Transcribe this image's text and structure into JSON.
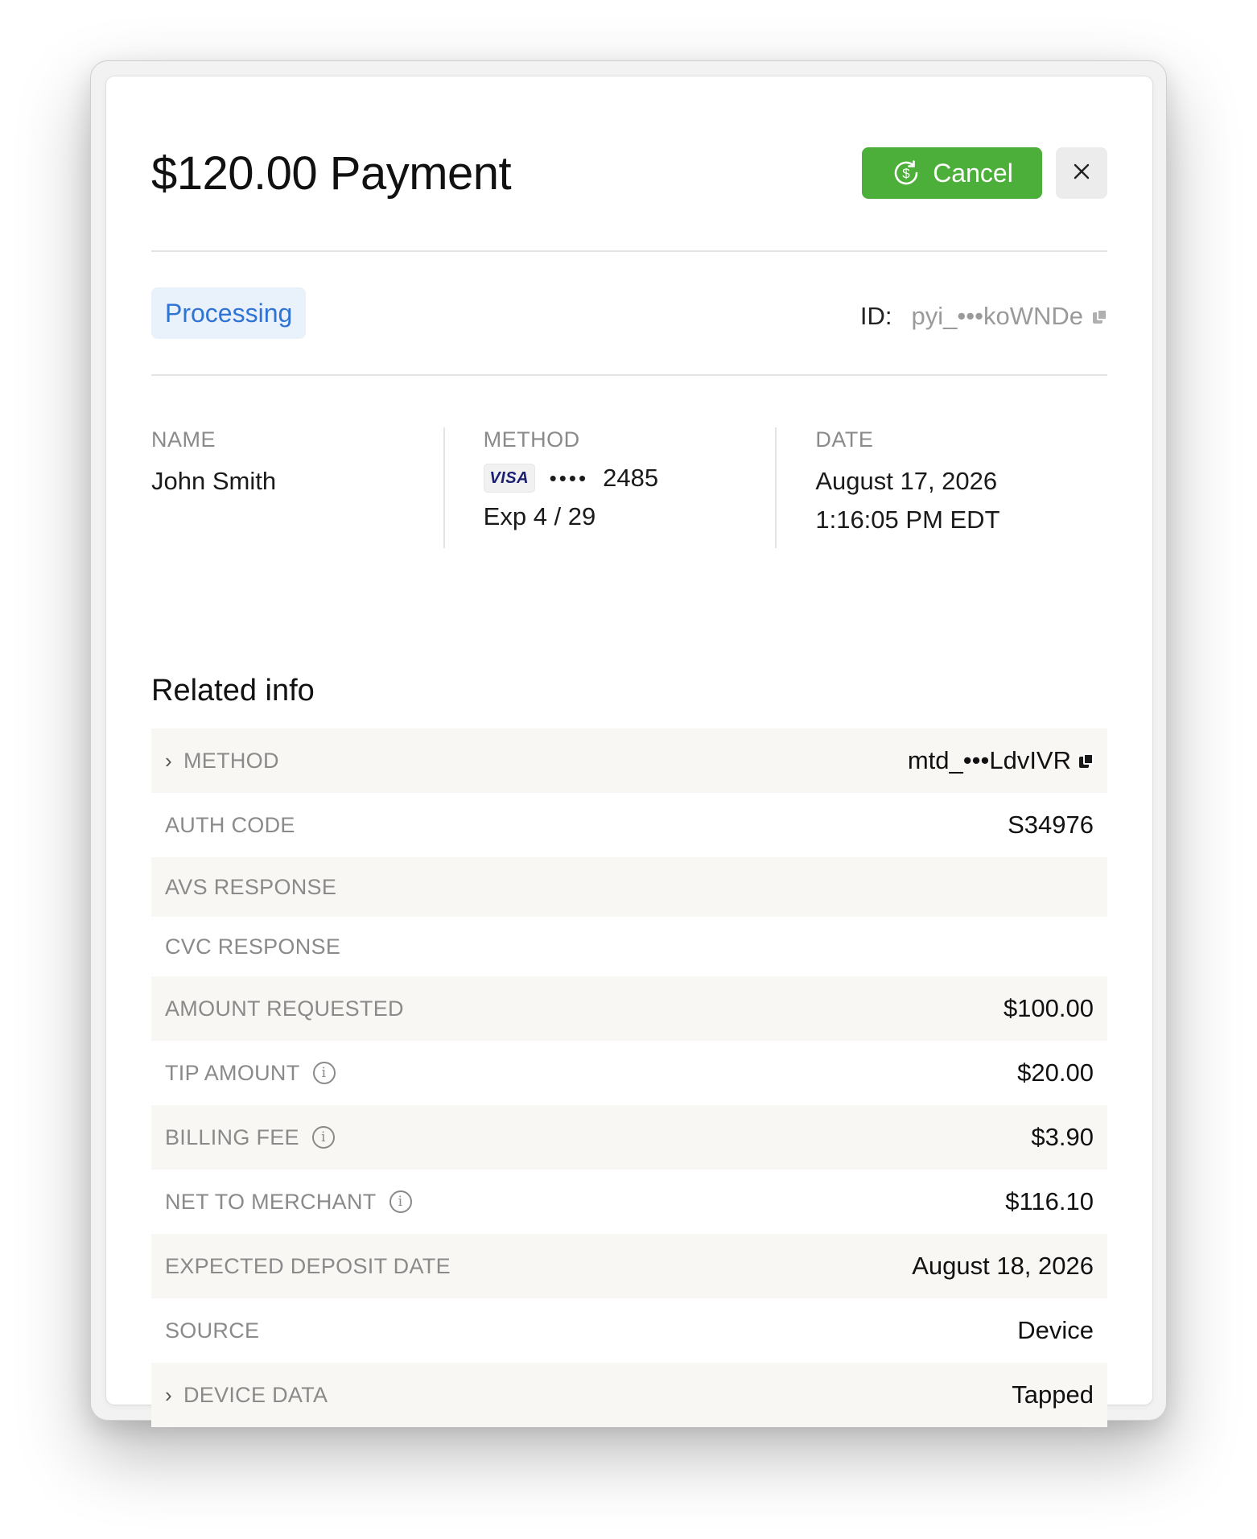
{
  "header": {
    "title": "$120.00 Payment",
    "cancel_label": "Cancel",
    "close_icon": "close-icon"
  },
  "status": {
    "badge": "Processing",
    "id_label": "ID:",
    "id_value": "pyi_•••koWNDe"
  },
  "info": {
    "name_label": "NAME",
    "name_value": "John Smith",
    "method_label": "METHOD",
    "card_brand": "VISA",
    "card_mask": "••••",
    "card_last4": "2485",
    "card_exp": "Exp 4 / 29",
    "date_label": "DATE",
    "date_value": "August 17, 2026",
    "time_value": "1:16:05 PM EDT"
  },
  "related": {
    "title": "Related info",
    "rows": [
      {
        "key": "METHOD",
        "value": "mtd_•••LdvIVR"
      },
      {
        "key": "AUTH CODE",
        "value": "S34976"
      },
      {
        "key": "AVS RESPONSE",
        "value": ""
      },
      {
        "key": "CVC RESPONSE",
        "value": ""
      },
      {
        "key": "AMOUNT REQUESTED",
        "value": "$100.00"
      },
      {
        "key": "TIP AMOUNT",
        "value": "$20.00"
      },
      {
        "key": "BILLING FEE",
        "value": "$3.90"
      },
      {
        "key": "NET TO MERCHANT",
        "value": "$116.10"
      },
      {
        "key": "EXPECTED DEPOSIT DATE",
        "value": "August 18, 2026"
      },
      {
        "key": "SOURCE",
        "value": "Device"
      },
      {
        "key": "DEVICE DATA",
        "value": "Tapped"
      }
    ]
  },
  "colors": {
    "accent_green": "#4caf3a",
    "status_blue": "#2f73d4",
    "status_bg": "#e9f1fb"
  }
}
